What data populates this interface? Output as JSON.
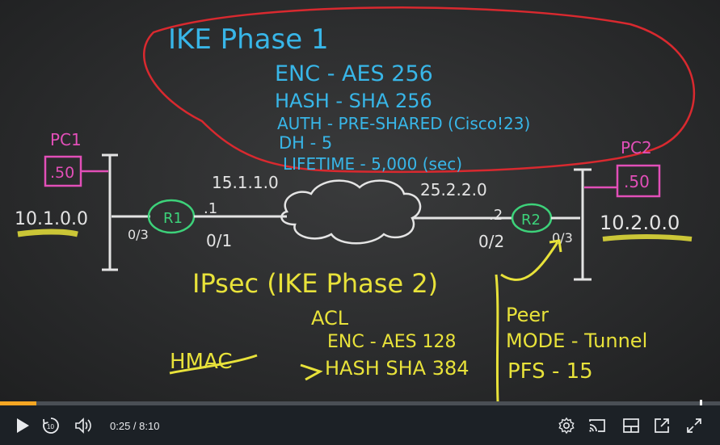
{
  "whiteboard": {
    "phase1_title": "IKE Phase 1",
    "phase1_items": [
      "ENC - AES 256",
      "HASH - SHA 256",
      "AUTH - PRE-SHARED (Cisco!23)",
      "DH - 5",
      "LIFETIME - 5,000 (sec)"
    ],
    "pc1_label": "PC1",
    "pc1_addr": ".50",
    "pc2_label": "PC2",
    "pc2_addr": ".50",
    "net_left": "10.1.0.0",
    "net_right": "10.2.0.0",
    "link_left": "15.1.1.0",
    "link_right": "25.2.2.0",
    "r1_label": "R1",
    "r2_label": "R2",
    "r1_host": ".1",
    "r2_host": ".2",
    "r1_if_lan": "0/3",
    "r1_if_wan": "0/1",
    "r2_if_wan": "0/2",
    "r2_if_lan": "0/3",
    "phase2_title": "IPsec (IKE Phase 2)",
    "phase2_items": [
      "ACL",
      "ENC - AES 128",
      "HASH SHA 384"
    ],
    "hmac": "HMAC",
    "peer": "Peer",
    "mode": "MODE - Tunnel",
    "pfs": "PFS - 15"
  },
  "player": {
    "time_current": "0:25",
    "time_separator": " / ",
    "time_total": "8:10",
    "progress_fraction": 0.051,
    "accent_color": "#f5a623",
    "icons": [
      "play-icon",
      "rewind-10-icon",
      "volume-icon",
      "settings-icon",
      "cast-icon",
      "theater-mode-icon",
      "popout-icon",
      "fullscreen-icon"
    ]
  }
}
